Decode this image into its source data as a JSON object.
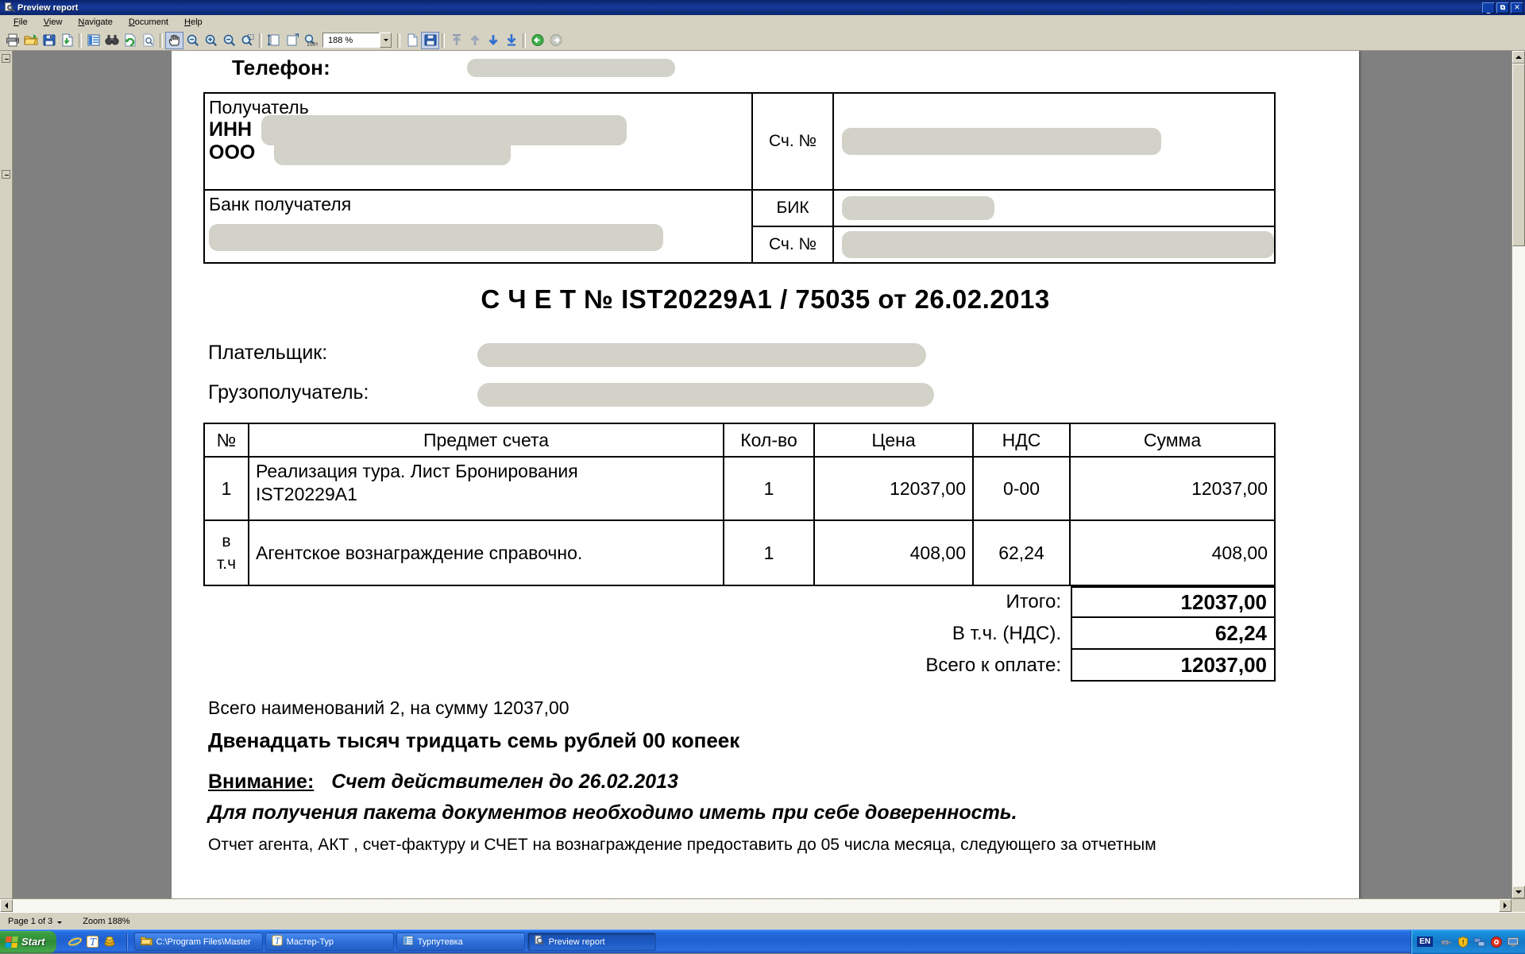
{
  "window": {
    "title": "Preview report",
    "sys_icon": "preview-report-icon",
    "minimize": "_",
    "maximize": "❐",
    "close": "✕"
  },
  "menu": [
    {
      "label": "File",
      "mnemonic": "F"
    },
    {
      "label": "View",
      "mnemonic": "V"
    },
    {
      "label": "Navigate",
      "mnemonic": "N"
    },
    {
      "label": "Document",
      "mnemonic": "D"
    },
    {
      "label": "Help",
      "mnemonic": "H"
    }
  ],
  "toolbar": {
    "zoom_value": "188 %",
    "buttons": [
      {
        "name": "print-icon",
        "title": "Print"
      },
      {
        "name": "open-folder-icon",
        "title": "Open"
      },
      {
        "name": "save-icon",
        "title": "Save"
      },
      {
        "name": "export-icon",
        "title": "Export"
      },
      {
        "name": "page-list-icon",
        "title": "Thumbnails"
      },
      {
        "name": "find-binoculars-icon",
        "title": "Find"
      },
      {
        "name": "refresh-icon",
        "title": "Refresh"
      },
      {
        "name": "page-preview-icon",
        "title": "Preview"
      },
      {
        "name": "hand-tool-icon",
        "title": "Hand tool",
        "active": true
      },
      {
        "name": "zoom-tool-icon",
        "title": "Zoom"
      },
      {
        "name": "zoom-in-icon",
        "title": "Zoom in"
      },
      {
        "name": "zoom-out-icon",
        "title": "Zoom out"
      },
      {
        "name": "zoom-selection-icon",
        "title": "Zoom to selection"
      },
      {
        "name": "fit-height-icon",
        "title": "Fit height"
      },
      {
        "name": "fit-page-icon",
        "title": "Fit page"
      },
      {
        "name": "zoom-100-icon",
        "title": "Actual size"
      },
      {
        "name": "new-page-icon",
        "title": "New page"
      },
      {
        "name": "save-page-icon",
        "title": "Save page"
      },
      {
        "name": "first-page-icon",
        "title": "First page"
      },
      {
        "name": "prev-page-icon",
        "title": "Previous page"
      },
      {
        "name": "next-page-icon",
        "title": "Next page"
      },
      {
        "name": "last-page-icon",
        "title": "Last page"
      },
      {
        "name": "back-icon",
        "title": "Back"
      },
      {
        "name": "forward-icon",
        "title": "Forward"
      }
    ]
  },
  "document": {
    "phone_label": "Телефон:",
    "bank": {
      "recipient_label": "Получатель",
      "inn_label": "ИНН",
      "ooo_label": "ООО",
      "bank_label": "Банк получателя",
      "account_label": "Сч. №",
      "bik_label": "БИК",
      "account2_label": "Сч. №"
    },
    "title": "С Ч Е Т  № IST20229A1 / 75035 от 26.02.2013",
    "payer_label": "Плательщик:",
    "consignee_label": "Грузополучатель:",
    "table": {
      "headers": [
        "№",
        "Предмет счета",
        "Кол-во",
        "Цена",
        "НДС",
        "Сумма"
      ],
      "rows": [
        {
          "num": "1",
          "subject_line1": "Реализация тура. Лист Бронирования",
          "subject_line2": "IST20229A1",
          "qty": "1",
          "price": "12037,00",
          "vat": "0-00",
          "sum": "12037,00"
        },
        {
          "num_line1": "в",
          "num_line2": "т.ч",
          "subject_line1": "Агентское вознаграждение справочно.",
          "subject_line2": "",
          "qty": "1",
          "price": "408,00",
          "vat": "62,24",
          "sum": "408,00"
        }
      ]
    },
    "totals": [
      {
        "label": "Итого:",
        "value": "12037,00"
      },
      {
        "label": "В т.ч. (НДС).",
        "value": "62,24"
      },
      {
        "label": "Всего к оплате:",
        "value": "12037,00"
      }
    ],
    "summary_line": "Всего наименований 2, на сумму 12037,00",
    "amount_in_words": "Двенадцать тысяч тридцать семь рублей 00 копеек",
    "attention_label": "Внимание:",
    "attention_text": "Счет действителен до 26.02.2013",
    "power_of_attorney": "Для получения пакета документов необходимо иметь при себе доверенность.",
    "fine_print": "Отчет агента, АКТ , счет-фактуру и СЧЕТ на вознаграждение предоставить  до 05 числа месяца, следующего за отчетным"
  },
  "statusbar": {
    "page_info": "Page 1 of 3",
    "zoom_info": "Zoom 188%"
  },
  "taskbar": {
    "start_label": "Start",
    "quicklaunch": [
      {
        "name": "internet-explorer-icon"
      },
      {
        "name": "turbo-t-icon"
      },
      {
        "name": "coins-icon"
      }
    ],
    "items": [
      {
        "label": "C:\\Program Files\\Master",
        "icon": "folder-icon",
        "active": false
      },
      {
        "label": "Мастер-Тур",
        "icon": "turbo-t-icon",
        "active": false
      },
      {
        "label": "Турпутевка",
        "icon": "window-list-icon",
        "active": false
      },
      {
        "label": "Preview report",
        "icon": "preview-report-icon",
        "active": true
      }
    ],
    "tray": {
      "language": "EN",
      "icons": [
        {
          "name": "network-icon"
        },
        {
          "name": "security-shield-icon"
        },
        {
          "name": "network-connection-icon"
        },
        {
          "name": "record-icon"
        },
        {
          "name": "monitor-icon"
        }
      ]
    }
  },
  "colors": {
    "titlebar": "#0a246a",
    "chrome": "#d6d2c2",
    "desktop": "#808080",
    "redaction": "#d2d2c8",
    "taskbar": "#225fd0"
  }
}
